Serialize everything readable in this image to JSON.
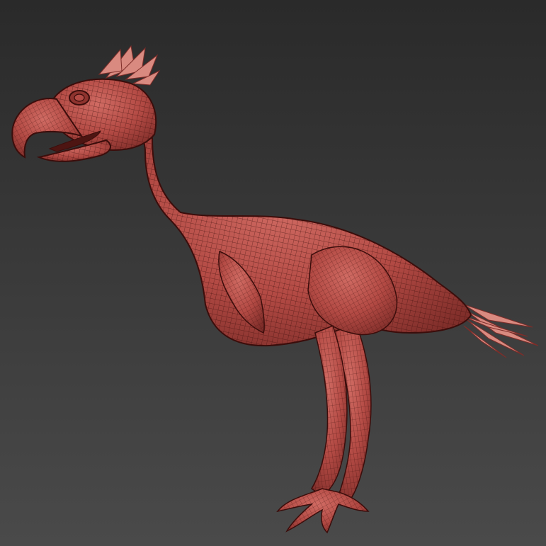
{
  "viewport": {
    "background_top": "#2a2a2a",
    "background_bottom": "#4a4a4a",
    "model": "bird-creature-wireframe-mesh",
    "mesh_fill": "#b34a44",
    "mesh_fill_dark": "#7e2d29",
    "mesh_fill_light": "#d06b63",
    "wire_color": "#3b0d0b",
    "feather_color": "#d98a80"
  }
}
